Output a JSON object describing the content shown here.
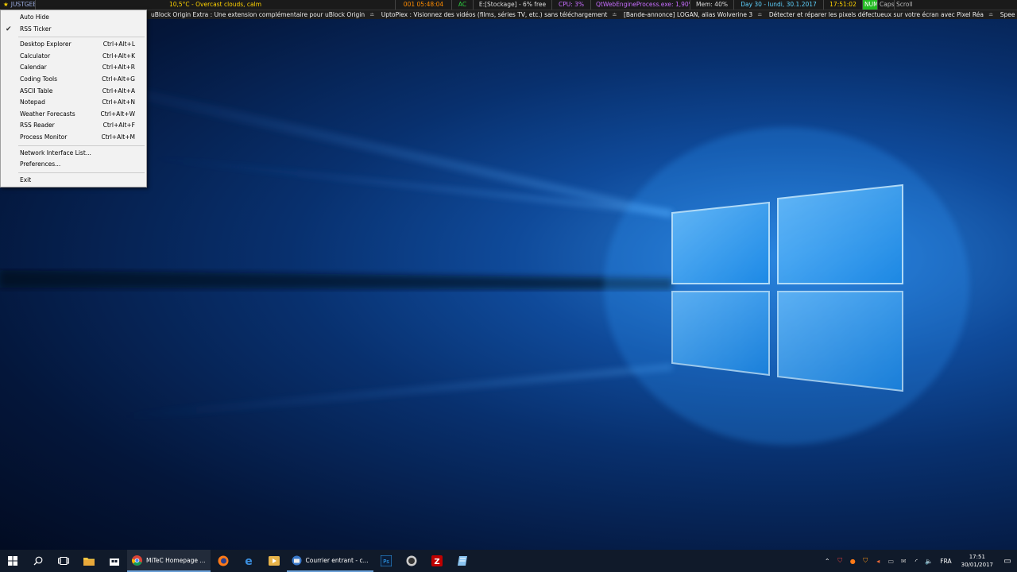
{
  "topbar": {
    "brand": "JUSTGEEK",
    "weather": "10,5°C - Overcast clouds, calm",
    "timer": "001 05:48:04",
    "power": "AC",
    "disk": "E:[Stockage] - 6% free",
    "cpu": "CPU: 3%",
    "process": "QtWebEngineProcess.exe: 1,90%",
    "mem": "Mem: 40%",
    "day": "Day 30 - lundi, 30.1.2017",
    "clock": "17:51:02",
    "num": "NUM",
    "caps": "Caps",
    "scroll": "Scroll"
  },
  "ticker": {
    "items": [
      "uBlock Origin Extra : Une extension complémentaire pour uBlock Origin",
      "UptoPlex : Visionnez des vidéos (films, séries TV, etc.) sans téléchargement",
      "[Bande-annonce] LOGAN, alias Wolverine 3",
      "Détecter et réparer les pixels défectueux sur votre écran avec Pixel Réa",
      "Spee"
    ],
    "separator": "≐"
  },
  "menu": {
    "group1": [
      {
        "label": "Auto Hide",
        "checked": false
      },
      {
        "label": "RSS Ticker",
        "checked": true
      }
    ],
    "group2": [
      {
        "label": "Desktop Explorer",
        "shortcut": "Ctrl+Alt+L"
      },
      {
        "label": "Calculator",
        "shortcut": "Ctrl+Alt+K"
      },
      {
        "label": "Calendar",
        "shortcut": "Ctrl+Alt+R"
      },
      {
        "label": "Coding Tools",
        "shortcut": "Ctrl+Alt+G"
      },
      {
        "label": "ASCII Table",
        "shortcut": "Ctrl+Alt+A"
      },
      {
        "label": "Notepad",
        "shortcut": "Ctrl+Alt+N"
      },
      {
        "label": "Weather Forecasts",
        "shortcut": "Ctrl+Alt+W"
      },
      {
        "label": "RSS Reader",
        "shortcut": "Ctrl+Alt+F"
      },
      {
        "label": "Process Monitor",
        "shortcut": "Ctrl+Alt+M"
      }
    ],
    "group3": [
      {
        "label": "Network Interface List..."
      },
      {
        "label": "Preferences..."
      }
    ],
    "group4": [
      {
        "label": "Exit"
      }
    ]
  },
  "taskbar": {
    "apps": [
      {
        "label": "MiTeC Homepage ...",
        "icon": "chrome-icon"
      },
      {
        "label": "Courrier entrant - c...",
        "icon": "thunderbird-icon"
      }
    ],
    "language": "FRA",
    "time": "17:51",
    "date": "30/01/2017"
  },
  "colors": {
    "weather": "#ffd200",
    "timer": "#ff8c00",
    "cpu": "#c76dff",
    "day": "#5ed2ff",
    "num_bg": "#22bb22"
  }
}
